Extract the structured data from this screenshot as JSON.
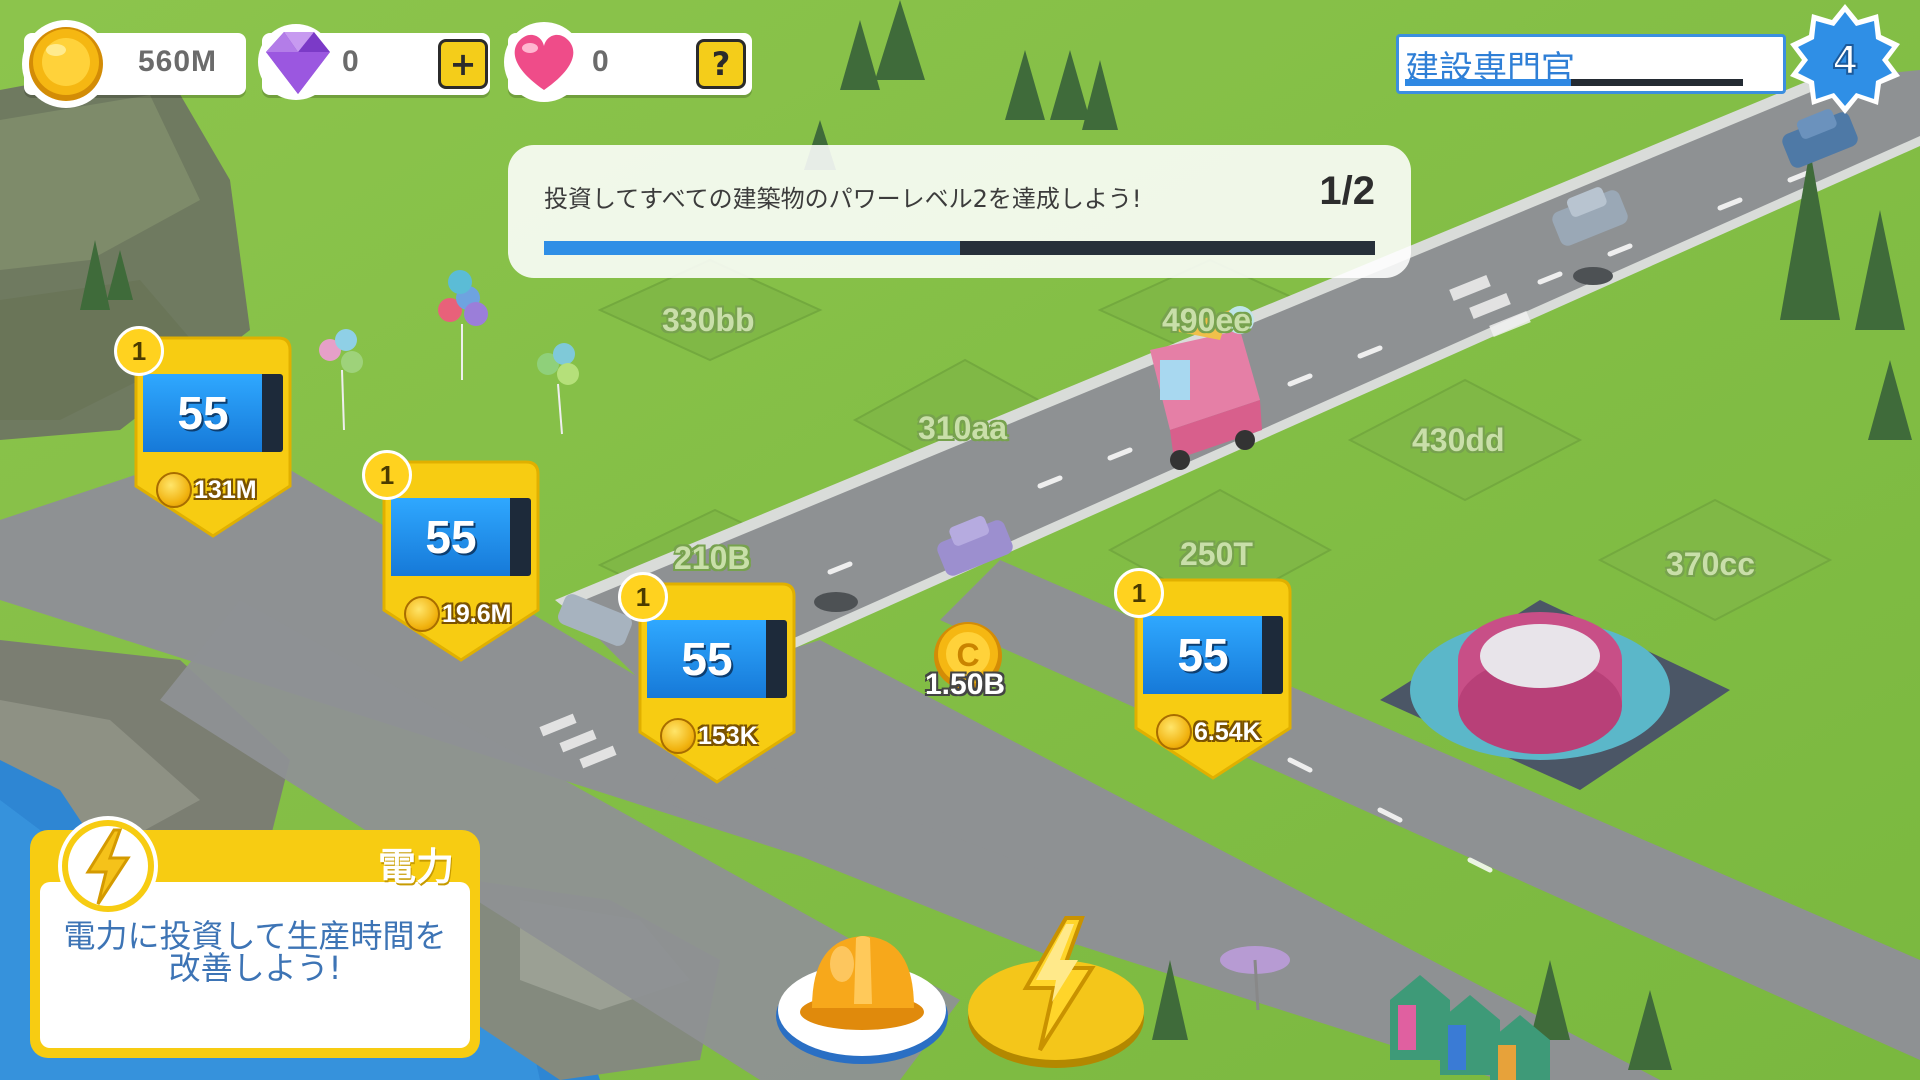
{
  "hud": {
    "coins": "560M",
    "gems": "0",
    "hearts": "0",
    "add_label": "+",
    "help_label": "?",
    "title": "建設専門官",
    "title_progress": 0.49,
    "player_level": "4"
  },
  "quest": {
    "text": "投資してすべての建築物のパワーレベル2を達成しよう!",
    "count": "1/2",
    "progress": 0.5
  },
  "plots": [
    "330bb",
    "490ee",
    "310aa",
    "430dd",
    "210B",
    "250T",
    "370cc"
  ],
  "buildings": [
    {
      "tier": "1",
      "level": "55",
      "cost": "131M"
    },
    {
      "tier": "1",
      "level": "55",
      "cost": "19.6M"
    },
    {
      "tier": "1",
      "level": "55",
      "cost": "153K"
    },
    {
      "tier": "1",
      "level": "55",
      "cost": "6.54K"
    }
  ],
  "ground_coin": {
    "symbol": "C",
    "value": "1.50B"
  },
  "power_panel": {
    "title": "電力",
    "desc_line1": "電力に投資して生産時間を",
    "desc_line2": "改善しよう!"
  },
  "icons": {
    "coin": "coin-icon",
    "gem": "gem-icon",
    "heart": "heart-icon",
    "bolt": "lightning-bolt-icon",
    "helmet": "hard-hat-icon",
    "level_star": "level-badge-icon"
  },
  "colors": {
    "grass": "#8ac24a",
    "road": "#8a8d8f",
    "accent_yellow": "#f7cc12",
    "level_blue": "#2f88e3"
  }
}
